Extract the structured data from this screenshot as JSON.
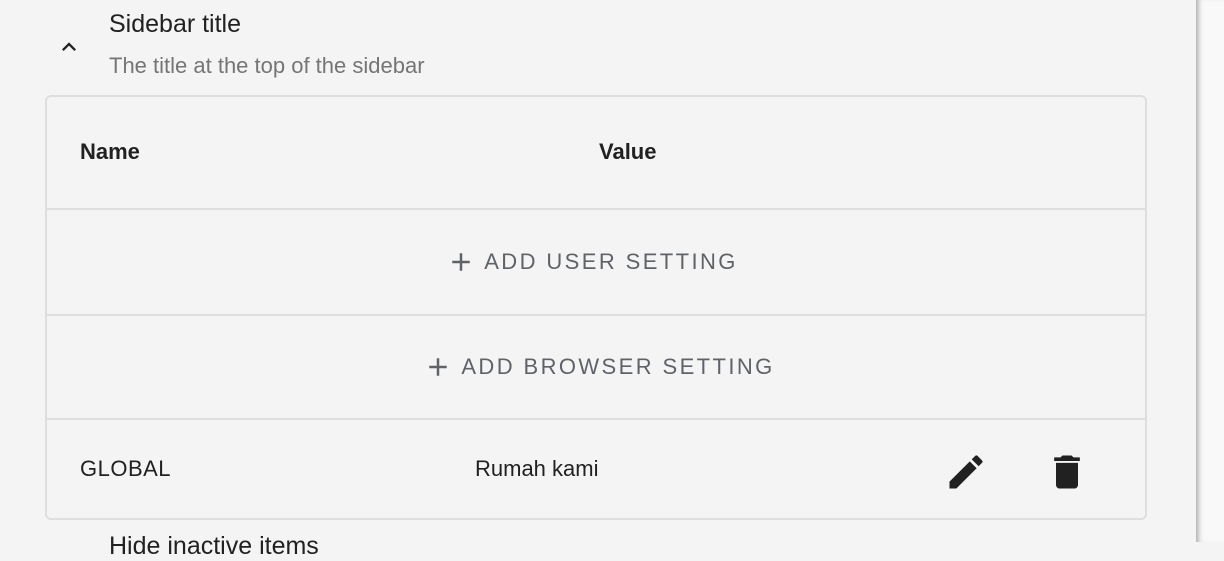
{
  "section": {
    "title": "Sidebar title",
    "subtitle": "The title at the top of the sidebar",
    "collapse_icon": "chevron-up-icon"
  },
  "table": {
    "columns": [
      "Name",
      "Value"
    ],
    "add_user_label": "ADD USER SETTING",
    "add_browser_label": "ADD BROWSER SETTING",
    "rows": [
      {
        "name": "GLOBAL",
        "value": "Rumah kami",
        "actions": [
          "pencil-icon",
          "trash-icon"
        ]
      }
    ]
  },
  "next_section": {
    "title": "Hide inactive items"
  },
  "colors": {
    "background": "#f4f4f4",
    "border": "#dedede",
    "text_primary": "#212121",
    "text_secondary": "#757575",
    "button_text": "#5f6368"
  }
}
